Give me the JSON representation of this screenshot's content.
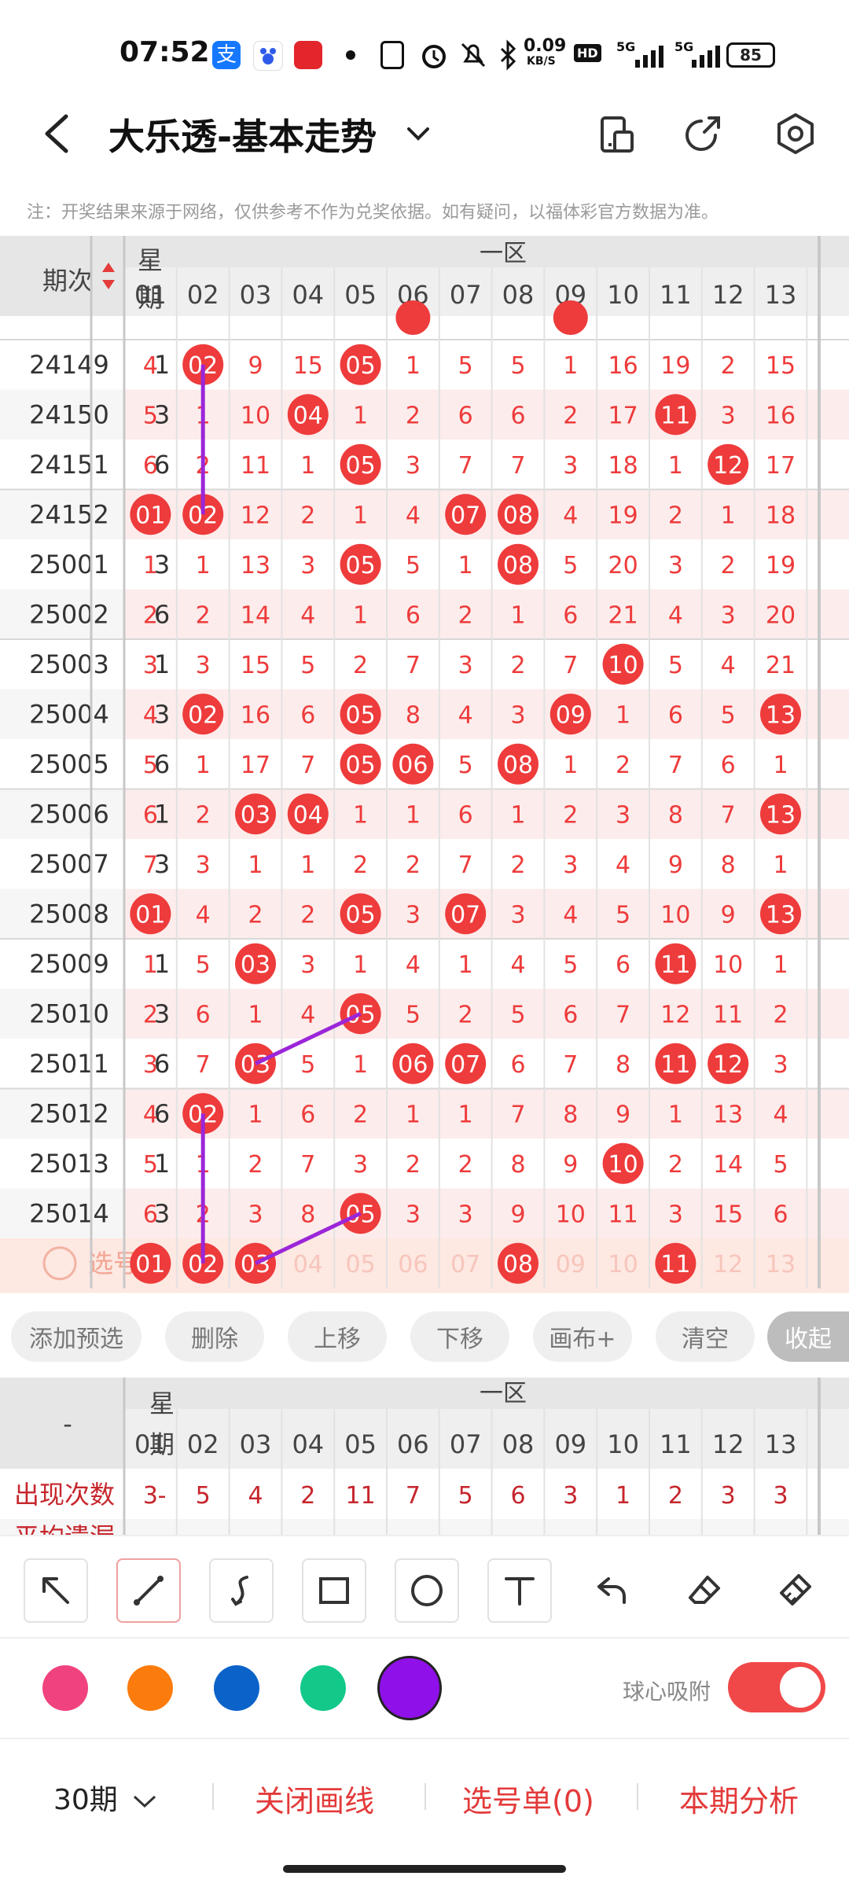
{
  "status_bar": {
    "time": "07:52",
    "speed": "0.09",
    "speed_unit": "KB/S",
    "battery": "85",
    "net1": "5G",
    "net2": "5G",
    "hd": "HD"
  },
  "header": {
    "title": "大乐透-基本走势",
    "icons": [
      "back-icon",
      "chevron-down-icon",
      "phone-mode-icon",
      "share-icon",
      "settings-icon"
    ]
  },
  "notice": "注：开奖结果来源于网络，仅供参考不作为兑奖依据。如有疑问，以福体彩官方数据为准。",
  "table": {
    "col_issue": "期次",
    "col_week_1": "星",
    "col_week_2": "期",
    "zone": "一区",
    "numbers": [
      "01",
      "02",
      "03",
      "04",
      "05",
      "06",
      "07",
      "08",
      "09",
      "10",
      "11",
      "12",
      "13"
    ],
    "rows": [
      {
        "issue": "24149",
        "week": "1",
        "cells": [
          "4",
          "02",
          "9",
          "15",
          "05",
          "1",
          "5",
          "5",
          "1",
          "16",
          "19",
          "2",
          "15"
        ]
      },
      {
        "issue": "24150",
        "week": "3",
        "cells": [
          "5",
          "1",
          "10",
          "04",
          "1",
          "2",
          "6",
          "6",
          "2",
          "17",
          "11",
          "3",
          "16"
        ]
      },
      {
        "issue": "24151",
        "week": "6",
        "cells": [
          "6",
          "2",
          "11",
          "1",
          "05",
          "3",
          "7",
          "7",
          "3",
          "18",
          "1",
          "12",
          "17"
        ]
      },
      {
        "issue": "24152",
        "week": "1",
        "cells": [
          "01",
          "02",
          "12",
          "2",
          "1",
          "4",
          "07",
          "08",
          "4",
          "19",
          "2",
          "1",
          "18"
        ]
      },
      {
        "issue": "25001",
        "week": "3",
        "cells": [
          "1",
          "1",
          "13",
          "3",
          "05",
          "5",
          "1",
          "08",
          "5",
          "20",
          "3",
          "2",
          "19"
        ]
      },
      {
        "issue": "25002",
        "week": "6",
        "cells": [
          "2",
          "2",
          "14",
          "4",
          "1",
          "6",
          "2",
          "1",
          "6",
          "21",
          "4",
          "3",
          "20"
        ]
      },
      {
        "issue": "25003",
        "week": "1",
        "cells": [
          "3",
          "3",
          "15",
          "5",
          "2",
          "7",
          "3",
          "2",
          "7",
          "10",
          "5",
          "4",
          "21"
        ]
      },
      {
        "issue": "25004",
        "week": "3",
        "cells": [
          "4",
          "02",
          "16",
          "6",
          "05",
          "8",
          "4",
          "3",
          "09",
          "1",
          "6",
          "5",
          "13"
        ]
      },
      {
        "issue": "25005",
        "week": "6",
        "cells": [
          "5",
          "1",
          "17",
          "7",
          "05",
          "06",
          "5",
          "08",
          "1",
          "2",
          "7",
          "6",
          "1"
        ]
      },
      {
        "issue": "25006",
        "week": "1",
        "cells": [
          "6",
          "2",
          "03",
          "04",
          "1",
          "1",
          "6",
          "1",
          "2",
          "3",
          "8",
          "7",
          "13"
        ]
      },
      {
        "issue": "25007",
        "week": "3",
        "cells": [
          "7",
          "3",
          "1",
          "1",
          "2",
          "2",
          "7",
          "2",
          "3",
          "4",
          "9",
          "8",
          "1"
        ]
      },
      {
        "issue": "25008",
        "week": "6",
        "cells": [
          "01",
          "4",
          "2",
          "2",
          "05",
          "3",
          "07",
          "3",
          "4",
          "5",
          "10",
          "9",
          "13"
        ]
      },
      {
        "issue": "25009",
        "week": "1",
        "cells": [
          "1",
          "5",
          "03",
          "3",
          "1",
          "4",
          "1",
          "4",
          "5",
          "6",
          "11",
          "10",
          "1"
        ]
      },
      {
        "issue": "25010",
        "week": "3",
        "cells": [
          "2",
          "6",
          "1",
          "4",
          "05",
          "5",
          "2",
          "5",
          "6",
          "7",
          "12",
          "11",
          "2"
        ]
      },
      {
        "issue": "25011",
        "week": "6",
        "cells": [
          "3",
          "7",
          "03",
          "5",
          "1",
          "06",
          "07",
          "6",
          "7",
          "8",
          "11",
          "12",
          "3"
        ]
      },
      {
        "issue": "25012",
        "week": "6",
        "cells": [
          "4",
          "02",
          "1",
          "6",
          "2",
          "1",
          "1",
          "7",
          "8",
          "9",
          "1",
          "13",
          "4"
        ]
      },
      {
        "issue": "25013",
        "week": "1",
        "cells": [
          "5",
          "1",
          "2",
          "7",
          "3",
          "2",
          "2",
          "8",
          "9",
          "10",
          "2",
          "14",
          "5"
        ]
      },
      {
        "issue": "25014",
        "week": "3",
        "cells": [
          "6",
          "2",
          "3",
          "8",
          "05",
          "3",
          "3",
          "9",
          "10",
          "11",
          "3",
          "15",
          "6"
        ]
      }
    ],
    "select_label": "选号",
    "select_row": [
      "01",
      "02",
      "03",
      "04",
      "05",
      "06",
      "07",
      "08",
      "09",
      "10",
      "11",
      "12",
      "13"
    ],
    "selected": [
      "01",
      "02",
      "03",
      "08",
      "11"
    ]
  },
  "actions": [
    "添加预选",
    "删除",
    "上移",
    "下移",
    "画布+",
    "清空",
    "收起"
  ],
  "stats": {
    "corner": "-",
    "col_week_1": "星",
    "col_week_2": "期",
    "zone": "一区",
    "numbers": [
      "01",
      "02",
      "03",
      "04",
      "05",
      "06",
      "07",
      "08",
      "09",
      "10",
      "11",
      "12",
      "13"
    ],
    "row1_label": "出现次数",
    "row1_week": "-",
    "row1_values": [
      "3",
      "5",
      "4",
      "2",
      "11",
      "7",
      "5",
      "6",
      "3",
      "1",
      "2",
      "3",
      "3"
    ],
    "row2_label": "平均遗漏"
  },
  "drawing_tools": [
    "arrow-tool-icon",
    "line-tool-icon",
    "curve-tool-icon",
    "rectangle-tool-icon",
    "circle-tool-icon",
    "text-tool-icon",
    "undo-icon",
    "eraser-icon",
    "clear-brush-icon"
  ],
  "palette": {
    "colors": [
      "#f0427e",
      "#fb7b0c",
      "#0b63c9",
      "#12c98a",
      "#8f10e8"
    ],
    "selected": "#8f10e8",
    "snap_label": "球心吸附",
    "snap_on": true
  },
  "bottom_bar": {
    "period": "30期",
    "close_lines": "关闭画线",
    "selection_list": "选号单(0)",
    "analysis": "本期分析"
  },
  "theme": {
    "red": "#ee3b3b",
    "accent_line": "#9b26d9"
  }
}
